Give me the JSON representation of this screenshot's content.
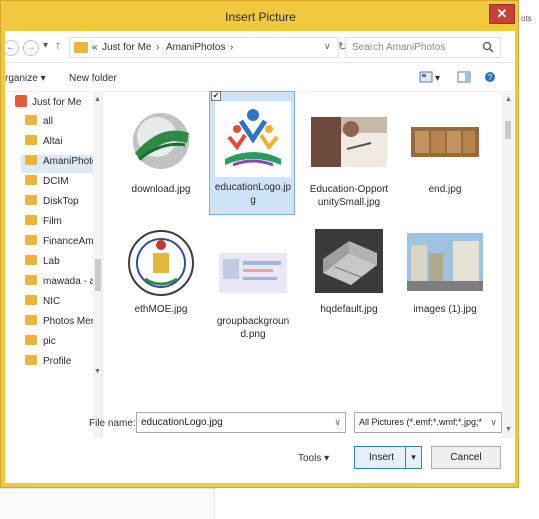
{
  "dialog": {
    "title": "Insert Picture",
    "close_glyph": "✕"
  },
  "background": {
    "side_text": "ots"
  },
  "nav_buttons": {
    "back": "←",
    "forward": "→",
    "dropdown": "▾",
    "up": "↑"
  },
  "address": {
    "crumbs": [
      "«",
      "Just for Me",
      "›",
      "AmaniPhotos",
      "›"
    ],
    "dropdown_glyph": "∨",
    "refresh_glyph": "↻"
  },
  "search": {
    "placeholder": "Search AmaniPhotos",
    "icon": "search-icon"
  },
  "toolbar": {
    "organize": "rganize ▾",
    "new_folder": "New folder",
    "view_dropdown": "▾"
  },
  "nav": {
    "items": [
      {
        "label": "Just for Me",
        "kind": "library"
      },
      {
        "label": "all"
      },
      {
        "label": "Altai"
      },
      {
        "label": "AmaniPhotos",
        "selected": true
      },
      {
        "label": "DCIM"
      },
      {
        "label": "DiskTop"
      },
      {
        "label": "Film"
      },
      {
        "label": "FinanceAmir"
      },
      {
        "label": "Lab"
      },
      {
        "label": "mawada - ak"
      },
      {
        "label": "NIC"
      },
      {
        "label": "Photos Mem"
      },
      {
        "label": "pic"
      },
      {
        "label": "Profile"
      }
    ],
    "scroll_up": "▲",
    "scroll_down": "▼"
  },
  "files": [
    {
      "name": "download.jpg"
    },
    {
      "name": "educationLogo.jpg",
      "selected": true
    },
    {
      "name": "Education-OpportunitySmall.jpg"
    },
    {
      "name": "end.jpg"
    },
    {
      "name": "ethMOE.jpg"
    },
    {
      "name": "groupbackground.png"
    },
    {
      "name": "hqdefault.jpg"
    },
    {
      "name": "images (1).jpg"
    }
  ],
  "file_name": {
    "label": "File name:",
    "value": "educationLogo.jpg",
    "dropdown_glyph": "∨"
  },
  "filter": {
    "value": "All Pictures (*.emf;*.wmf;*.jpg;*",
    "dropdown_glyph": "∨"
  },
  "tools": {
    "label": "Tools ▾"
  },
  "insert": {
    "label": "Insert",
    "split_glyph": "▾"
  },
  "cancel": {
    "label": "Cancel"
  },
  "checkmark": "✔"
}
